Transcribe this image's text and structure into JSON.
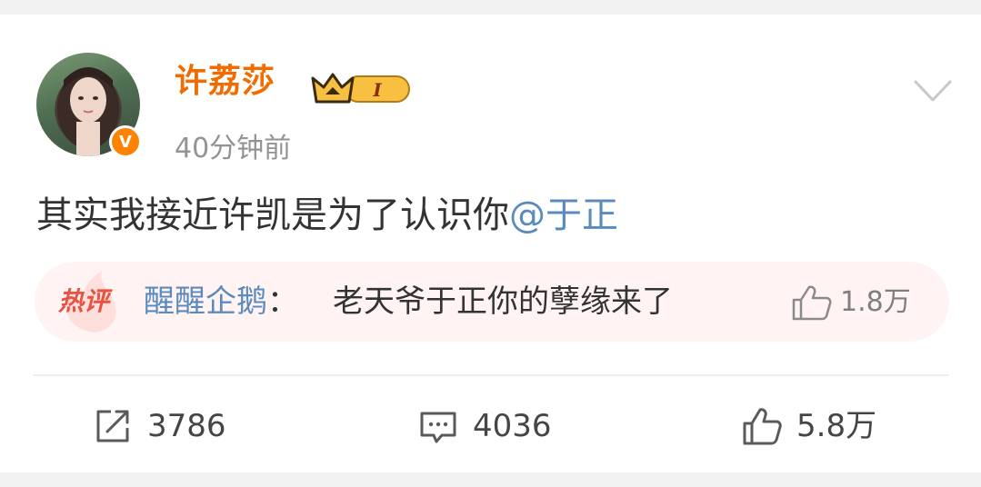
{
  "post": {
    "author": {
      "name": "许荔莎",
      "verified_badge": "V",
      "vip_level": "I",
      "avatar_icon": "user-avatar-photo"
    },
    "timestamp": "40分钟前",
    "text": "其实我接近许凯是为了认识你",
    "mention": "@于正"
  },
  "hot_comment": {
    "label": "热评",
    "commenter": "醒醒企鹅",
    "colon": "：",
    "text": "老天爷于正你的孽缘来了",
    "likes": "1.8万"
  },
  "actions": {
    "repost_count": "3786",
    "comment_count": "4036",
    "like_count": "5.8万"
  },
  "colors": {
    "username": "#f06c00",
    "link": "#5b8bbd",
    "hot_label": "#e85243",
    "hot_bg": "#fff4f3"
  }
}
